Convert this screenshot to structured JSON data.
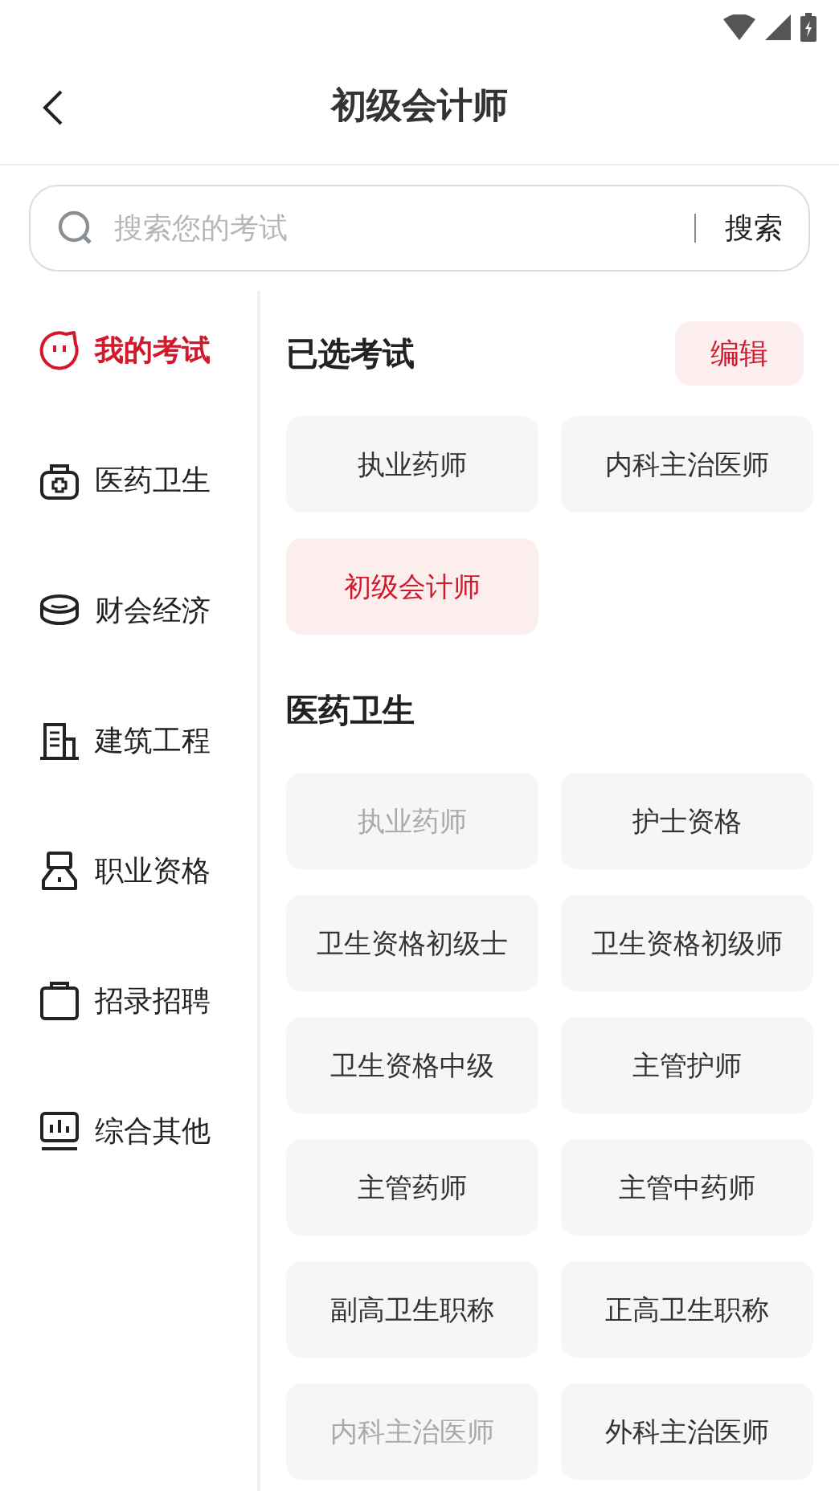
{
  "header": {
    "title": "初级会计师"
  },
  "search": {
    "placeholder": "搜索您的考试",
    "button": "搜索"
  },
  "sidebar": {
    "items": [
      {
        "label": "我的考试",
        "selected": true
      },
      {
        "label": "医药卫生",
        "selected": false
      },
      {
        "label": "财会经济",
        "selected": false
      },
      {
        "label": "建筑工程",
        "selected": false
      },
      {
        "label": "职业资格",
        "selected": false
      },
      {
        "label": "招录招聘",
        "selected": false
      },
      {
        "label": "综合其他",
        "selected": false
      }
    ]
  },
  "sections": [
    {
      "title": "已选考试",
      "action": "编辑",
      "exams": [
        {
          "label": "执业药师",
          "selected": false,
          "disabled": false
        },
        {
          "label": "内科主治医师",
          "selected": false,
          "disabled": false
        },
        {
          "label": "初级会计师",
          "selected": true,
          "disabled": false
        }
      ]
    },
    {
      "title": "医药卫生",
      "exams": [
        {
          "label": "执业药师",
          "selected": false,
          "disabled": true
        },
        {
          "label": "护士资格",
          "selected": false,
          "disabled": false
        },
        {
          "label": "卫生资格初级士",
          "selected": false,
          "disabled": false
        },
        {
          "label": "卫生资格初级师",
          "selected": false,
          "disabled": false
        },
        {
          "label": "卫生资格中级",
          "selected": false,
          "disabled": false
        },
        {
          "label": "主管护师",
          "selected": false,
          "disabled": false
        },
        {
          "label": "主管药师",
          "selected": false,
          "disabled": false
        },
        {
          "label": "主管中药师",
          "selected": false,
          "disabled": false
        },
        {
          "label": "副高卫生职称",
          "selected": false,
          "disabled": false
        },
        {
          "label": "正高卫生职称",
          "selected": false,
          "disabled": false
        },
        {
          "label": "内科主治医师",
          "selected": false,
          "disabled": true
        },
        {
          "label": "外科主治医师",
          "selected": false,
          "disabled": false
        }
      ]
    }
  ]
}
